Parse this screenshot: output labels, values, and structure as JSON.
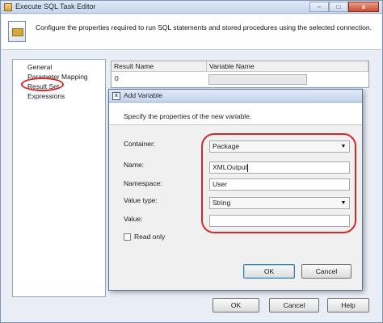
{
  "window": {
    "title": "Execute SQL Task Editor",
    "controls": {
      "minimize": "–",
      "maximize": "□",
      "close": "x"
    }
  },
  "header": {
    "description": "Configure the properties required to run SQL statements and stored procedures using the selected connection."
  },
  "sidebar": {
    "items": [
      {
        "label": "General"
      },
      {
        "label": "Parameter Mapping"
      },
      {
        "label": "Result Set",
        "selected": true
      },
      {
        "label": "Expressions"
      }
    ]
  },
  "result_grid": {
    "columns": [
      "Result Name",
      "Variable Name"
    ],
    "rows": [
      {
        "result_name": "0",
        "variable_name": ""
      }
    ]
  },
  "outer_buttons": {
    "ok": "OK",
    "cancel": "Cancel",
    "help": "Help"
  },
  "dialog": {
    "title": "Add Variable",
    "instruction": "Specify the properties of the new variable.",
    "fields": {
      "container": {
        "label": "Container:",
        "value": "Package"
      },
      "name": {
        "label": "Name:",
        "value": "XMLOutput"
      },
      "namespace": {
        "label": "Namespace:",
        "value": "User"
      },
      "value_type": {
        "label": "Value type:",
        "value": "String"
      },
      "value": {
        "label": "Value:",
        "value": ""
      }
    },
    "read_only": {
      "label": "Read only",
      "checked": false
    },
    "buttons": {
      "ok": "OK",
      "cancel": "Cancel"
    }
  },
  "annotation_color": "#d42a2a"
}
